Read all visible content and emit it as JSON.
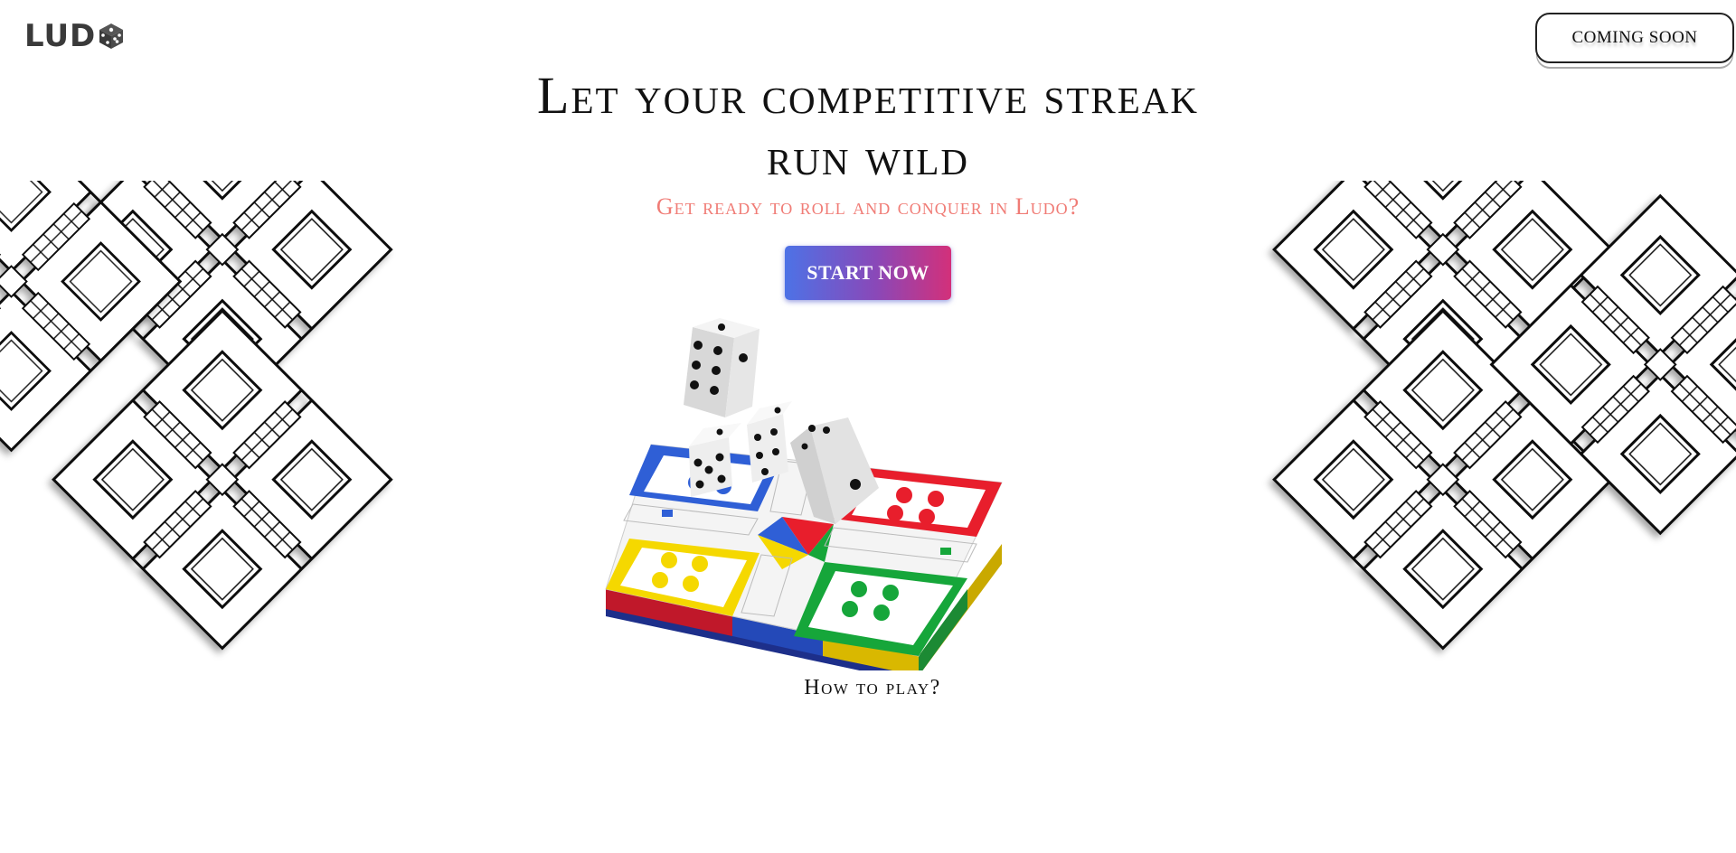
{
  "header": {
    "logo_text": "LUD",
    "logo_icon": "dice-icon",
    "coming_soon_label": "COMING SOON"
  },
  "hero": {
    "title_line1": "Let your competitive streak",
    "title_line2": "run wild",
    "subtitle": "Get ready to roll and conquer in Ludo?",
    "cta_label": "START NOW",
    "how_to_play": "How to play?"
  },
  "illustration": {
    "board_colors": {
      "blue": "#2f5fd6",
      "red": "#e81e2c",
      "yellow": "#f5d800",
      "green": "#16a63a"
    },
    "dice_faces_visible": [
      5,
      3,
      6,
      1
    ],
    "decorative_pattern": "ludo-board-outline-pattern"
  },
  "colors": {
    "subtitle": "#f07c76",
    "cta_gradient_start": "#4d72e6",
    "cta_gradient_end": "#d3307a",
    "text": "#111111"
  }
}
